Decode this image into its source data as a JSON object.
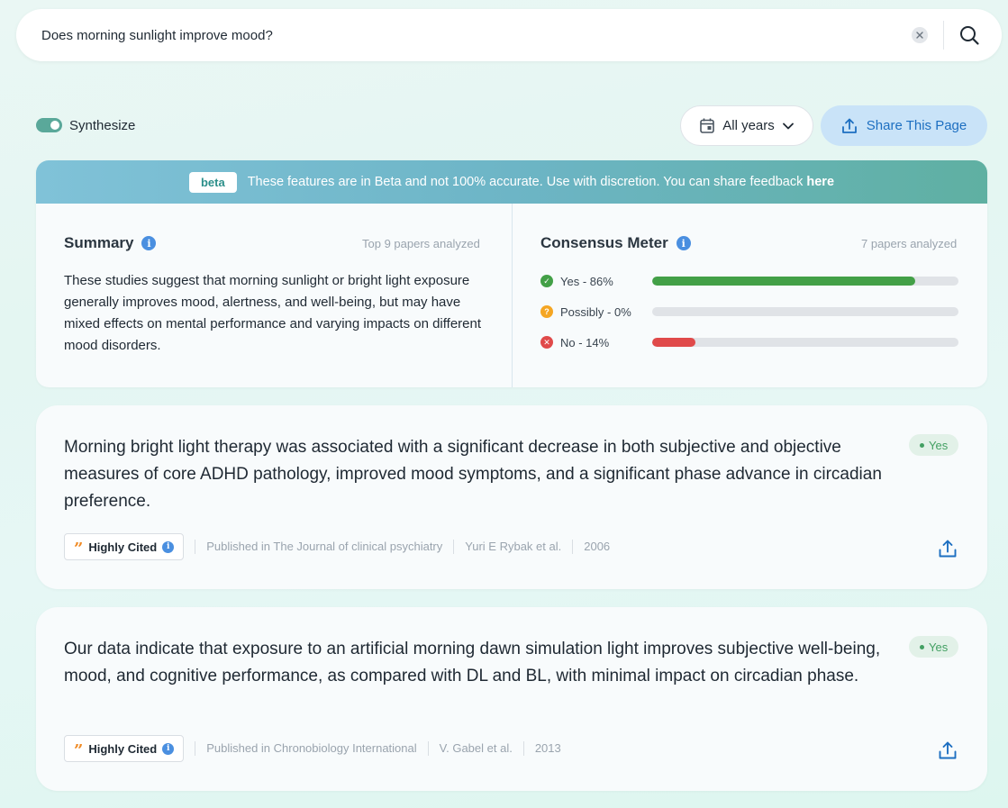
{
  "search": {
    "query": "Does morning sunlight improve mood?"
  },
  "controls": {
    "synthesize_label": "Synthesize",
    "synthesize_on": true,
    "years_label": "All years",
    "share_label": "Share This Page"
  },
  "banner": {
    "badge": "beta",
    "text": "These features are in Beta and not 100% accurate. Use with discretion. You can share feedback ",
    "link": "here"
  },
  "summary": {
    "title": "Summary",
    "meta": "Top 9 papers analyzed",
    "text": "These studies suggest that morning sunlight or bright light exposure generally improves mood, alertness, and well-being, but may have mixed effects on mental performance and varying impacts on different mood disorders."
  },
  "consensus": {
    "title": "Consensus Meter",
    "meta": "7 papers analyzed",
    "rows": [
      {
        "label": "Yes - 86%",
        "fraction": 0.86,
        "color": "#43a047",
        "icon": "check-icon"
      },
      {
        "label": "Possibly - 0%",
        "fraction": 0.0,
        "color": "#f5a623",
        "icon": "question-icon"
      },
      {
        "label": "No - 14%",
        "fraction": 0.14,
        "color": "#e04a4a",
        "icon": "cross-icon"
      }
    ]
  },
  "results": [
    {
      "text": "Morning bright light therapy was associated with a significant decrease in both subjective and objective measures of core ADHD pathology, improved mood symptoms, and a significant phase advance in circadian preference.",
      "answer": "Yes",
      "badge": "Highly Cited",
      "journal": "Published in The Journal of clinical psychiatry",
      "authors": "Yuri E Rybak et al.",
      "year": "2006"
    },
    {
      "text": "Our data indicate that exposure to an artificial morning dawn simulation light improves subjective well-being, mood, and cognitive performance, as compared with DL and BL, with minimal impact on circadian phase.",
      "answer": "Yes",
      "badge": "Highly Cited",
      "journal": "Published in Chronobiology International",
      "authors": "V. Gabel et al.",
      "year": "2013"
    }
  ],
  "colors": {
    "accent": "#5aa89a",
    "share_bg": "#c9e3f8",
    "share_text": "#1d6fc1",
    "yes": "#43a063"
  }
}
